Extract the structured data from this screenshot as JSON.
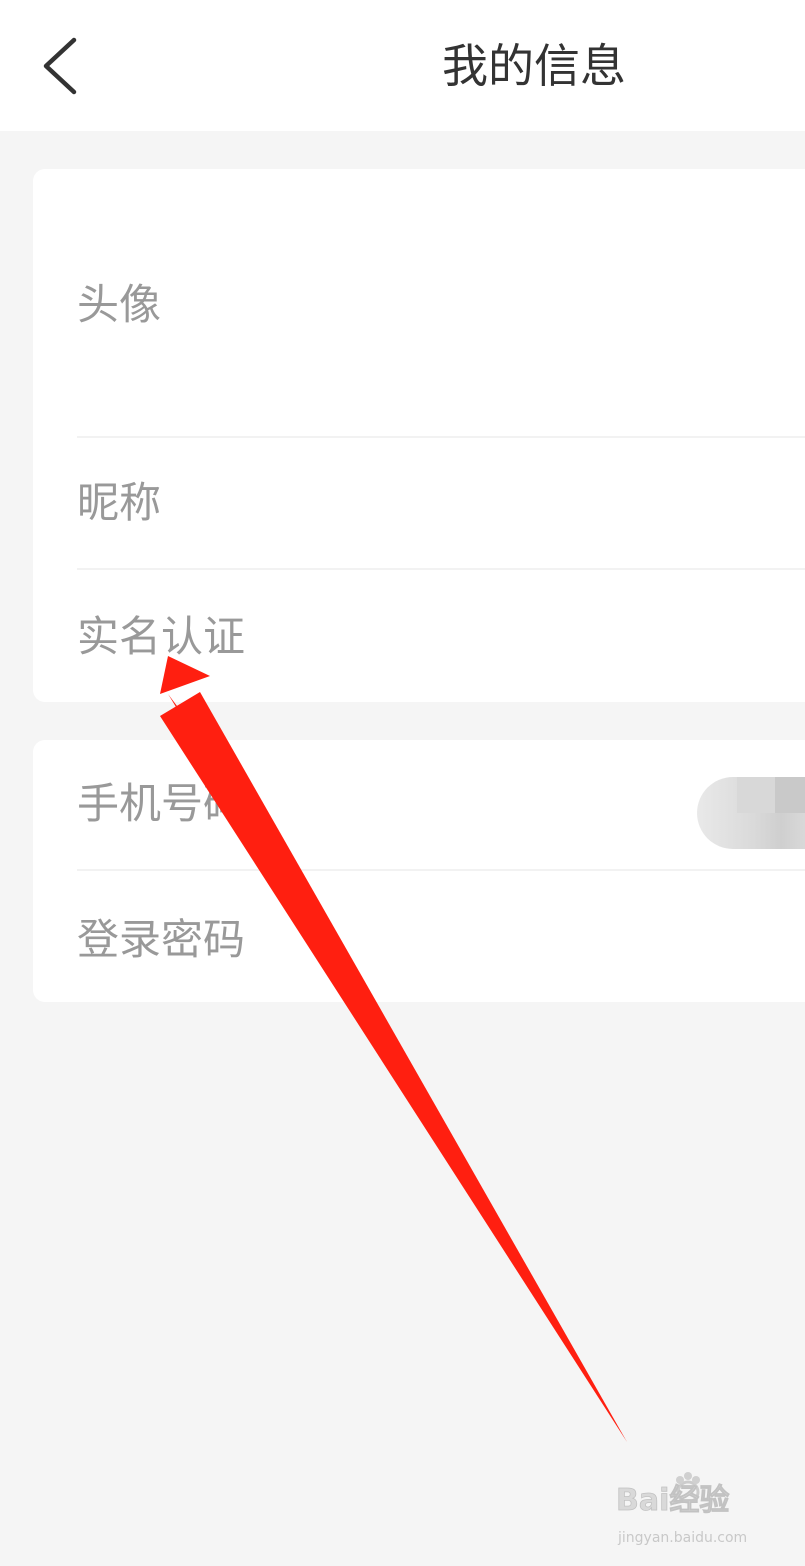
{
  "header": {
    "title": "我的信息",
    "back_icon": "chevron-left-icon"
  },
  "profile_section": {
    "items": [
      {
        "label": "头像"
      },
      {
        "label": "昵称"
      },
      {
        "label": "实名认证"
      }
    ]
  },
  "account_section": {
    "items": [
      {
        "label": "手机号码",
        "value_masked": true
      },
      {
        "label": "登录密码"
      }
    ]
  },
  "watermark": {
    "brand_text": "Bai经验",
    "url_text": "jingyan.baidu.com"
  },
  "colors": {
    "page_background": "#f5f5f5",
    "card_background": "#ffffff",
    "label_text": "#999999",
    "title_text": "#333333",
    "annotation_arrow": "#ff1f10"
  }
}
